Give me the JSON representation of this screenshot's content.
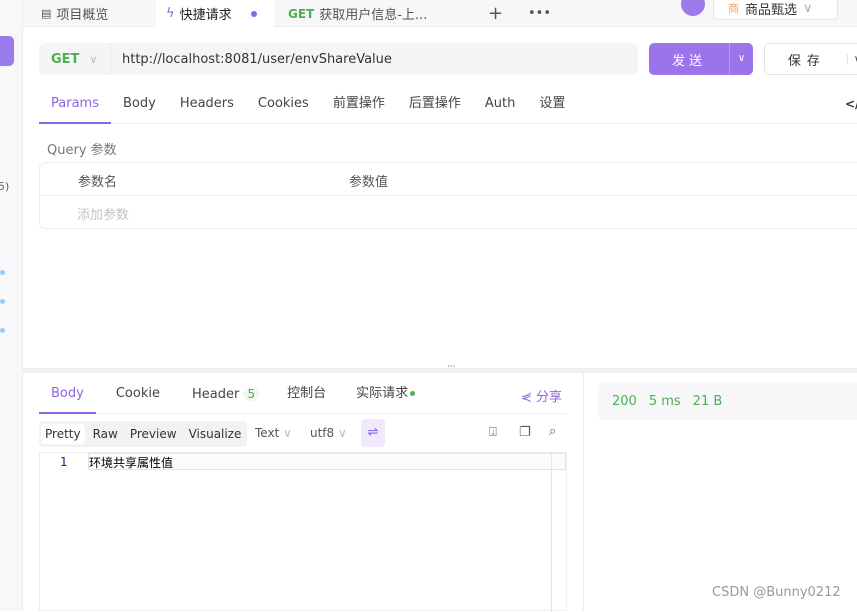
{
  "tabs": [
    {
      "label": "项目概览",
      "icon": "layout-icon"
    },
    {
      "label": "快捷请求",
      "icon": "lightning-icon"
    },
    {
      "method": "GET",
      "label": "获取用户信息-上..."
    }
  ],
  "top_right": {
    "project": "商品甄选",
    "badge": "商"
  },
  "request": {
    "method": "GET",
    "url": "http://localhost:8081/user/envShareValue",
    "send": "发送",
    "save": "保存"
  },
  "req_tabs": [
    "Params",
    "Body",
    "Headers",
    "Cookies",
    "前置操作",
    "后置操作",
    "Auth",
    "设置"
  ],
  "code_icon": "</>",
  "params": {
    "title": "Query 参数",
    "col_name": "参数名",
    "col_value": "参数值",
    "add_placeholder": "添加参数"
  },
  "response": {
    "tabs": [
      "Body",
      "Cookie",
      "Header",
      "控制台",
      "实际请求"
    ],
    "header_count": "5",
    "share": "分享",
    "formats": [
      "Pretty",
      "Raw",
      "Preview",
      "Visualize"
    ],
    "type": "Text",
    "encoding": "utf8",
    "lines": [
      {
        "num": "1",
        "text": "环境共享属性值"
      }
    ],
    "status": "200",
    "time": "5 ms",
    "size": "21 B"
  },
  "watermark": "CSDN @Bunny0212",
  "colors": {
    "accent": "#8a63e6",
    "get": "#4caf50"
  }
}
